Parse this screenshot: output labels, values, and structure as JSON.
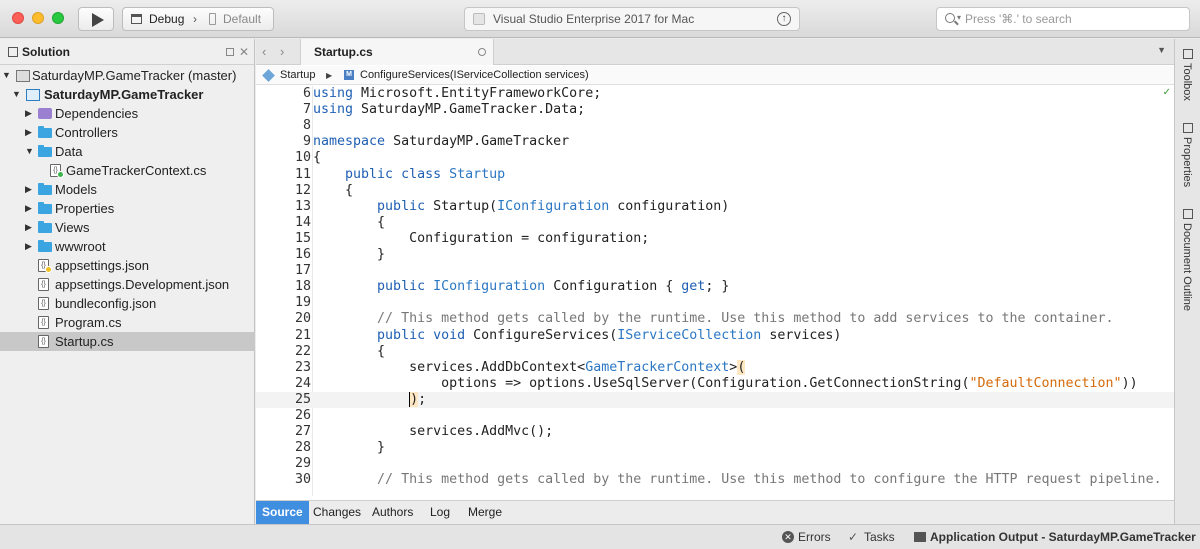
{
  "toolbar": {
    "configuration": "Debug",
    "chevron": "›",
    "device": "Default",
    "status": "Visual Studio Enterprise 2017 for Mac",
    "search_placeholder": "Press '⌘.' to search"
  },
  "solution_pad": {
    "title": "Solution",
    "close": "✕",
    "items": [
      {
        "label": "SaturdayMP.GameTracker (master)",
        "icon": "solution-icon",
        "toggle": "▼",
        "bold": false
      },
      {
        "label": "SaturdayMP.GameTracker",
        "icon": "project-icon",
        "toggle": "▼",
        "bold": true
      },
      {
        "label": "Dependencies",
        "icon": "dependencies-icon",
        "toggle": "▶"
      },
      {
        "label": "Controllers",
        "icon": "folder-icon",
        "toggle": "▶"
      },
      {
        "label": "Data",
        "icon": "folder-icon",
        "toggle": "▼"
      },
      {
        "label": "GameTrackerContext.cs",
        "icon": "cs-file-icon",
        "toggle": ""
      },
      {
        "label": "Models",
        "icon": "folder-icon",
        "toggle": "▶"
      },
      {
        "label": "Properties",
        "icon": "folder-icon",
        "toggle": "▶"
      },
      {
        "label": "Views",
        "icon": "folder-icon",
        "toggle": "▶"
      },
      {
        "label": "wwwroot",
        "icon": "folder-icon",
        "toggle": "▶"
      },
      {
        "label": "appsettings.json",
        "icon": "json-file-icon",
        "toggle": ""
      },
      {
        "label": "appsettings.Development.json",
        "icon": "json-file-icon",
        "toggle": ""
      },
      {
        "label": "bundleconfig.json",
        "icon": "json-file-icon",
        "toggle": ""
      },
      {
        "label": "Program.cs",
        "icon": "cs-file-icon",
        "toggle": ""
      },
      {
        "label": "Startup.cs",
        "icon": "cs-file-icon",
        "toggle": "",
        "selected": true
      }
    ]
  },
  "editor": {
    "nav_back": "‹",
    "nav_forward": "›",
    "tab_label": "Startup.cs",
    "tab_dropdown": "▼",
    "path_class": "Startup",
    "path_sep": "▶",
    "path_method_letter": "M",
    "path_method": "ConfigureServices(IServiceCollection services)",
    "lines": [
      {
        "n": "6",
        "html": "<span class=\"kw\">using</span> Microsoft.EntityFrameworkCore;"
      },
      {
        "n": "7",
        "html": "<span class=\"kw\">using</span> SaturdayMP.GameTracker.Data;"
      },
      {
        "n": "8",
        "html": ""
      },
      {
        "n": "9",
        "html": "<span class=\"kw\">namespace</span> SaturdayMP.GameTracker"
      },
      {
        "n": "10",
        "html": "{"
      },
      {
        "n": "11",
        "html": "    <span class=\"kw\">public class</span> <span class=\"ty\">Startup</span>"
      },
      {
        "n": "12",
        "html": "    {"
      },
      {
        "n": "13",
        "html": "        <span class=\"kw\">public</span> Startup(<span class=\"ty\">IConfiguration</span> configuration)"
      },
      {
        "n": "14",
        "html": "        {"
      },
      {
        "n": "15",
        "html": "            Configuration = configuration;"
      },
      {
        "n": "16",
        "html": "        }"
      },
      {
        "n": "17",
        "html": ""
      },
      {
        "n": "18",
        "html": "        <span class=\"kw\">public</span> <span class=\"ty\">IConfiguration</span> Configuration { <span class=\"kw\">get</span>; }"
      },
      {
        "n": "19",
        "html": ""
      },
      {
        "n": "20",
        "html": "        <span class=\"cm\">// This method gets called by the runtime. Use this method to add services to the container.</span>"
      },
      {
        "n": "21",
        "html": "        <span class=\"kw\">public void</span> ConfigureServices(<span class=\"ty\">IServiceCollection</span> services)"
      },
      {
        "n": "22",
        "html": "        {"
      },
      {
        "n": "23",
        "html": "            services.AddDbContext&lt;<span class=\"ty\">GameTrackerContext</span>&gt;<span class=\"brace-hl\">(</span>"
      },
      {
        "n": "24",
        "html": "                options =&gt; options.UseSqlServer(Configuration.GetConnectionString(<span class=\"st\">\"DefaultConnection\"</span>))"
      },
      {
        "n": "25",
        "html": "            <span class=\"caret\"></span><span class=\"brace-hl\">)</span>;",
        "current": true
      },
      {
        "n": "26",
        "html": ""
      },
      {
        "n": "27",
        "html": "            services.AddMvc();"
      },
      {
        "n": "28",
        "html": "        }"
      },
      {
        "n": "29",
        "html": ""
      },
      {
        "n": "30",
        "html": "        <span class=\"cm\">// This method gets called by the runtime. Use this method to configure the HTTP request pipeline.</span>"
      }
    ],
    "bottom_tabs": [
      "Source",
      "Changes",
      "Authors",
      "Log",
      "Merge"
    ],
    "active_bottom_tab": "Source"
  },
  "right_pads": [
    "Toolbox",
    "Properties",
    "Document Outline"
  ],
  "statusbar": {
    "errors": "Errors",
    "tasks": "Tasks",
    "output": "Application Output - SaturdayMP.GameTracker"
  },
  "colors": {
    "accent": "#3f8ee0",
    "keyword": "#1f5fb3",
    "type": "#2b77c4",
    "comment": "#777777",
    "string": "#d46a0a"
  }
}
